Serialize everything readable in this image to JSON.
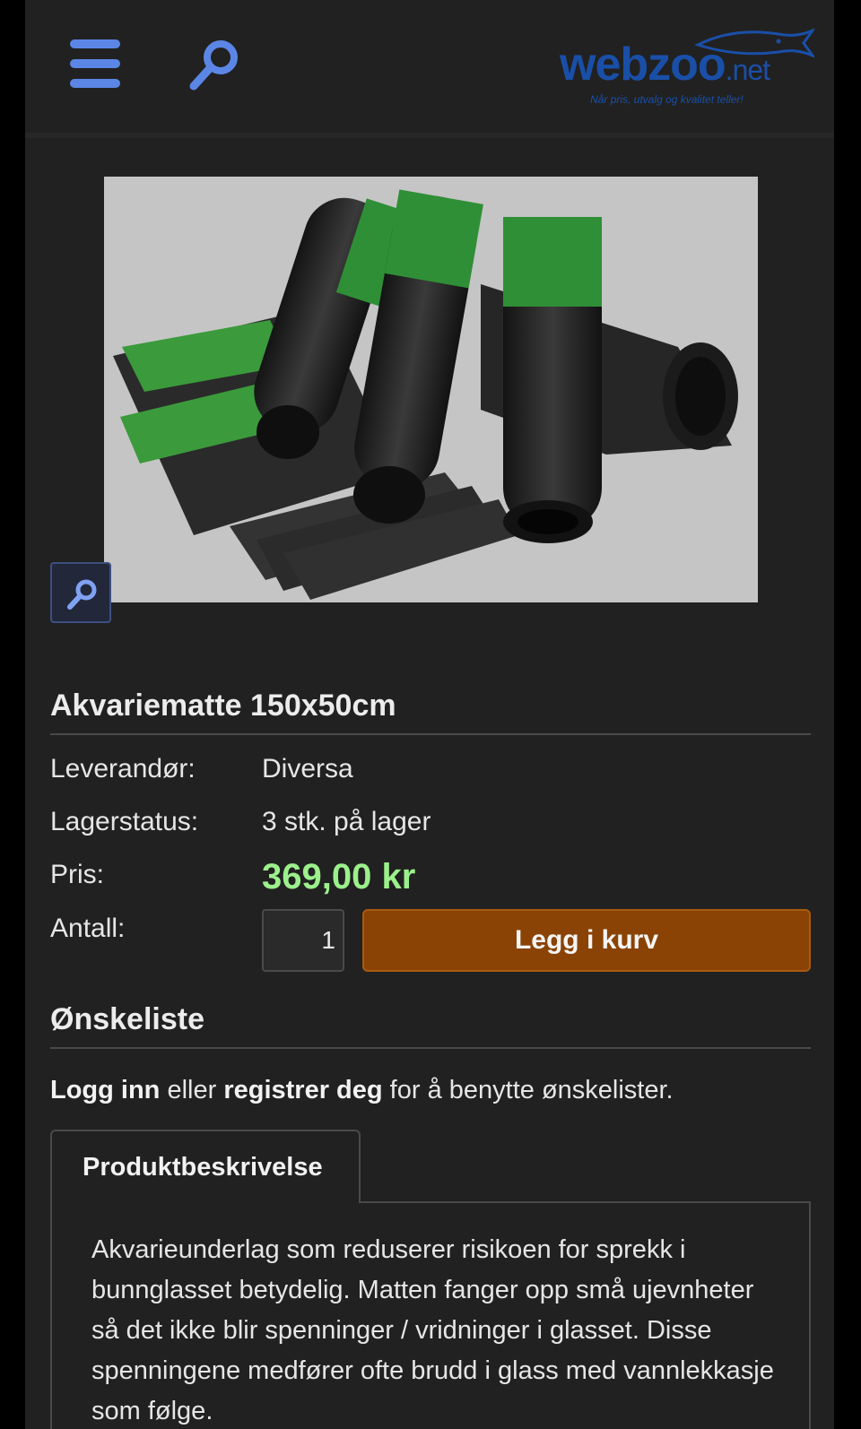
{
  "header": {
    "logo": {
      "name": "webzoo",
      "suffix": ".net",
      "tagline": "Når pris, utvalg og kvalitet teller!"
    },
    "menu_icon": "hamburger-menu-icon",
    "search_icon": "search-icon"
  },
  "product": {
    "image_alt": "Rolls and sheets of black aquarium mat with green labels",
    "zoom_icon": "zoom-icon",
    "title": "Akvariematte 150x50cm",
    "supplier_label": "Leverandør:",
    "supplier_value": "Diversa",
    "stock_label": "Lagerstatus:",
    "stock_value": "3 stk. på lager",
    "price_label": "Pris:",
    "price_value": "369,00 kr",
    "quantity_label": "Antall:",
    "quantity_value": "1",
    "add_to_cart_label": "Legg i kurv"
  },
  "wishlist": {
    "heading": "Ønskeliste",
    "login_link": "Logg inn",
    "text_or": " eller ",
    "register_link": "registrer deg",
    "text_suffix": " for å benytte ønskelister."
  },
  "tabs": [
    {
      "label": "Produktbeskrivelse",
      "content": "Akvarieunderlag som reduserer risikoen for sprekk i bunnglasset betydelig. Matten fanger opp små ujevnheter så det ikke blir spenninger / vridninger i glasset. Disse spenningene medfører ofte brudd i glass med vannlekkasje som følge."
    }
  ],
  "colors": {
    "background": "#212121",
    "accent_blue": "#5b86e5",
    "price_green": "#9cf08c",
    "cart_button": "#8a4305",
    "logo_blue": "#1a4fa8"
  }
}
